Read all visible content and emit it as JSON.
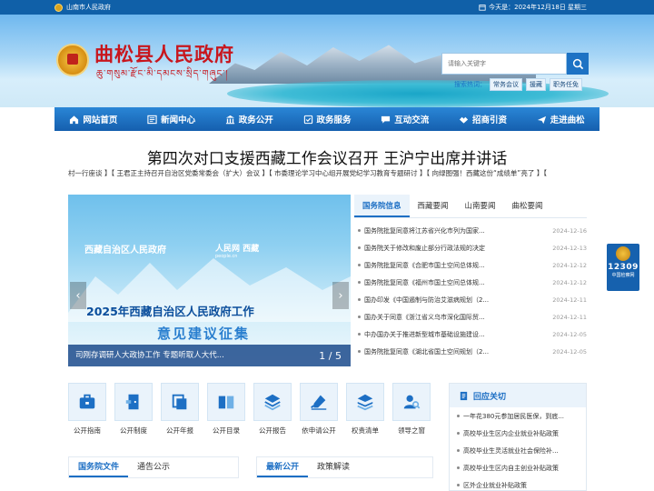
{
  "topbar": {
    "site": "山南市人民政府",
    "date": "今天是：2024年12月18日 星期三"
  },
  "banner": {
    "title": "曲松县人民政府",
    "subtitle": "ཆུ་གསུམ་རྫོང་མི་དམངས་སྲིད་གཞུང་།"
  },
  "search": {
    "placeholder": "请输入关键字"
  },
  "hot": {
    "label": "搜索热词：",
    "terms": [
      "常务会议",
      "援藏",
      "职务任免"
    ]
  },
  "nav": [
    {
      "label": "网站首页",
      "icon": "home-icon"
    },
    {
      "label": "新闻中心",
      "icon": "news-icon"
    },
    {
      "label": "政务公开",
      "icon": "building-icon"
    },
    {
      "label": "政务服务",
      "icon": "service-icon"
    },
    {
      "label": "互动交流",
      "icon": "chat-icon"
    },
    {
      "label": "招商引资",
      "icon": "handshake-icon"
    },
    {
      "label": "走进曲松",
      "icon": "plane-icon"
    }
  ],
  "headline": "第四次对口支援西藏工作会议召开 王沪宁出席并讲话",
  "ticker": "村一行座谈 】【 王君正主持召开自治区党委常委会（扩大）会议 】【 市委理论学习中心组开展党纪学习教育专题研讨 】【 向绿图强！西藏这份“成绩单”亮了 】【",
  "slide": {
    "org": "西藏自治区人民政府",
    "media": "人民网 西藏",
    "media_sub": "people.cn",
    "headline": "2025年西藏自治区人民政府工作",
    "big": "意见建议征集",
    "caption": "司刚存调研人大政协工作 专题听取人大代...",
    "page": "1 / 5"
  },
  "news": {
    "tabs": [
      "国务院信息",
      "西藏要闻",
      "山南要闻",
      "曲松要闻"
    ],
    "items": [
      {
        "t": "国务院批复同意将江苏省兴化市列为国家...",
        "d": "2024-12-16"
      },
      {
        "t": "国务院关于修改和废止部分行政法规的决定",
        "d": "2024-12-13"
      },
      {
        "t": "国务院批复同意《合肥市国土空间总体规...",
        "d": "2024-12-12"
      },
      {
        "t": "国务院批复同意《福州市国土空间总体规...",
        "d": "2024-12-12"
      },
      {
        "t": "国办印发《中国遏制与防治艾滋病规划（2...",
        "d": "2024-12-11"
      },
      {
        "t": "国办关于同意《浙江省义乌市深化国际贸...",
        "d": "2024-12-11"
      },
      {
        "t": "中办国办关于推进新型城市基础设施建设...",
        "d": "2024-12-05"
      },
      {
        "t": "国务院批复同意《湖北省国土空间规划（2...",
        "d": "2024-12-05"
      }
    ]
  },
  "side": {
    "number": "12309",
    "sub": "中国检察网"
  },
  "quick": [
    {
      "label": "公开指南",
      "icon": "briefcase-icon"
    },
    {
      "label": "公开制度",
      "icon": "door-icon"
    },
    {
      "label": "公开年报",
      "icon": "copy-icon"
    },
    {
      "label": "公开目录",
      "icon": "book-icon"
    },
    {
      "label": "公开报告",
      "icon": "layers-icon"
    },
    {
      "label": "依申请公开",
      "icon": "pen-icon"
    },
    {
      "label": "权责清单",
      "icon": "stack-icon"
    },
    {
      "label": "领导之窗",
      "icon": "person-search-icon"
    }
  ],
  "reply": {
    "title": "回应关切",
    "items": [
      "一年花380元参加居民医保，到底...",
      "高校毕业生区内企业就业补贴政策",
      "高校毕业生灵活就业社会保险补...",
      "高校毕业生区内自主创业补贴政策",
      "区外企业就业补贴政策"
    ]
  },
  "bottom_left": {
    "tabs": [
      "国务院文件",
      "通告公示"
    ]
  },
  "bottom_right": {
    "tabs": [
      "最新公开",
      "政策解读"
    ]
  },
  "colors": {
    "primary": "#1d6fc4",
    "title_red": "#c8161d",
    "nav_dark": "#155fae"
  }
}
